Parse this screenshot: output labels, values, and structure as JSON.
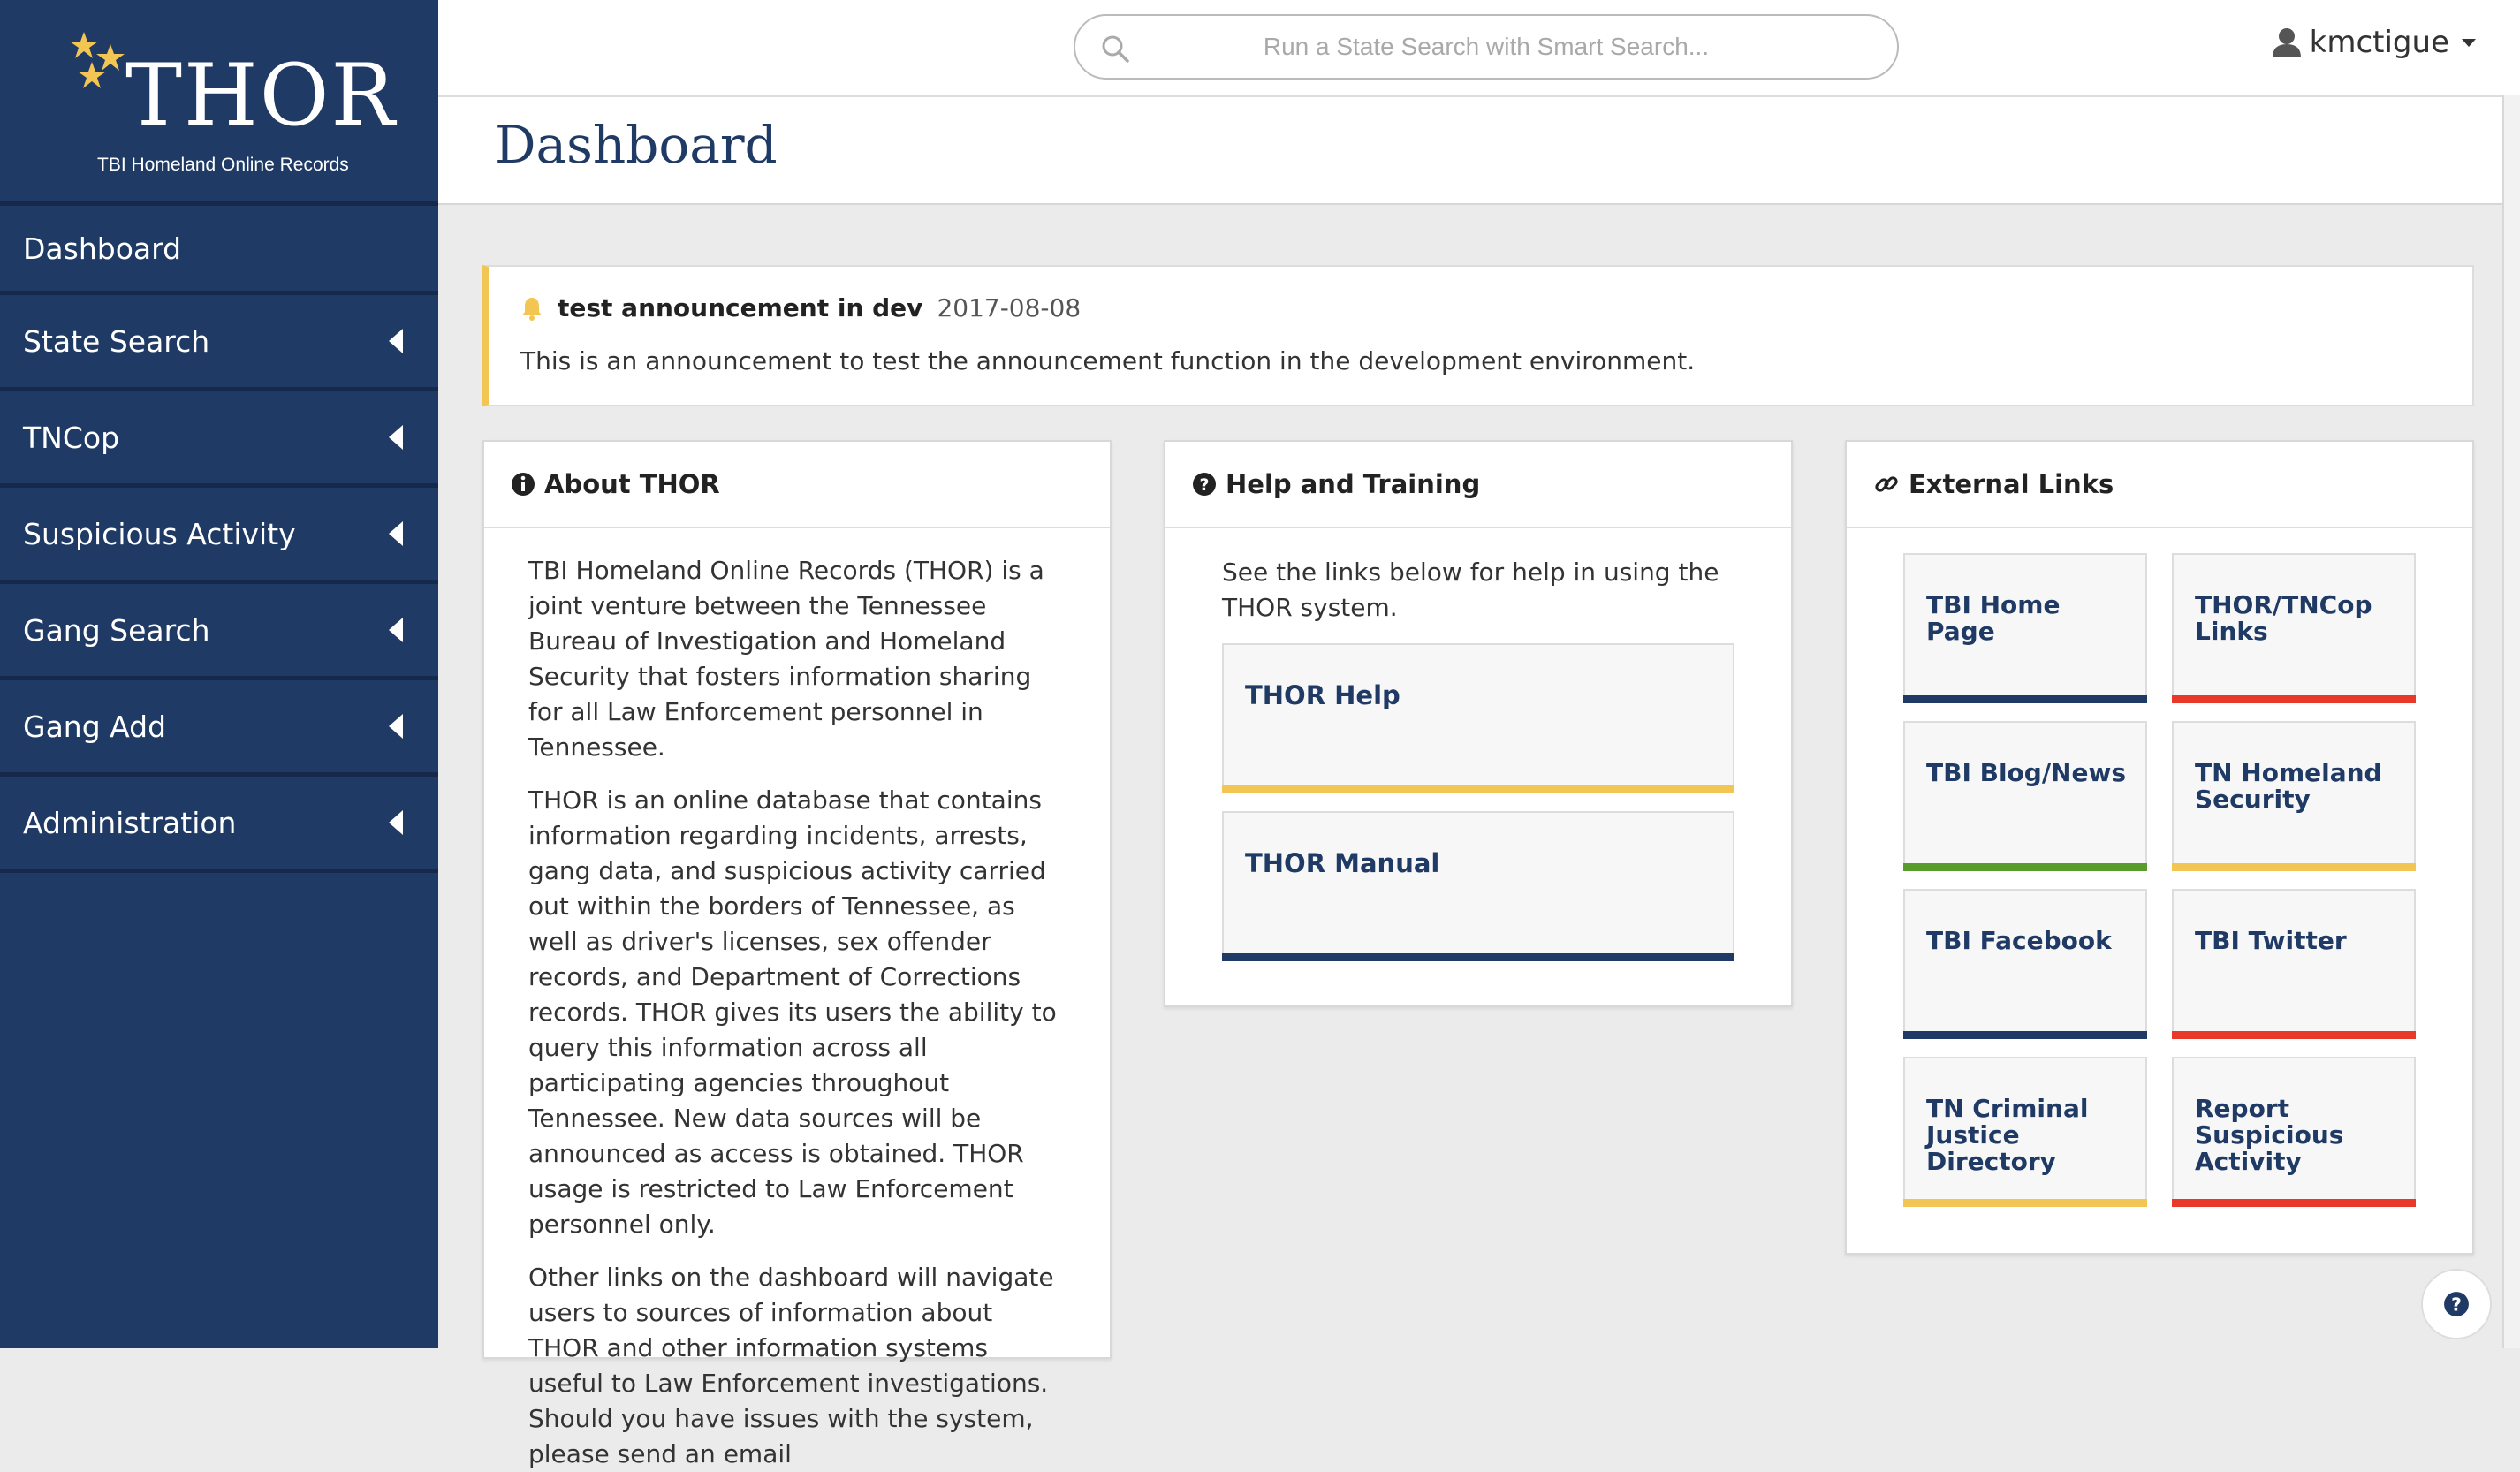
{
  "brand": {
    "name": "THOR",
    "tagline": "TBI Homeland Online Records"
  },
  "sidebar": {
    "items": [
      {
        "label": "Dashboard"
      },
      {
        "label": "State Search"
      },
      {
        "label": "TNCop"
      },
      {
        "label": "Suspicious Activity"
      },
      {
        "label": "Gang Search"
      },
      {
        "label": "Gang Add"
      },
      {
        "label": "Administration"
      }
    ]
  },
  "header": {
    "search_placeholder": "Run a State Search with Smart Search...",
    "username": "kmctigue"
  },
  "page": {
    "title": "Dashboard"
  },
  "announcement": {
    "title": "test announcement in dev",
    "date": "2017-08-08",
    "body": "This is an announcement to test the announcement function in the development environment."
  },
  "about": {
    "heading": "About THOR",
    "paragraphs": [
      "TBI Homeland Online Records (THOR) is a joint venture between the Tennessee Bureau of Investigation and Homeland Security that fosters information sharing for all Law Enforcement personnel in Tennessee.",
      "THOR is an online database that contains information regarding incidents, arrests, gang data, and suspicious activity carried out within the borders of Tennessee, as well as driver's licenses, sex offender records, and Department of Corrections records. THOR gives its users the ability to query this information across all participating agencies throughout Tennessee. New data sources will be announced as access is obtained. THOR usage is restricted to Law Enforcement personnel only.",
      "Other links on the dashboard will navigate users to sources of information about THOR and other information systems useful to Law Enforcement investigations. Should you have issues with the system, please send an email"
    ]
  },
  "help": {
    "heading": "Help and Training",
    "intro": "See the links below for help in using the THOR system.",
    "tiles": [
      {
        "label": "THOR Help",
        "color": "#f3c553"
      },
      {
        "label": "THOR Manual",
        "color": "#1f3a64"
      }
    ]
  },
  "links": {
    "heading": "External Links",
    "tiles": [
      {
        "label": "TBI Home Page",
        "color": "#1f3a64"
      },
      {
        "label": "THOR/TNCop Links",
        "color": "#e8392b"
      },
      {
        "label": "TBI Blog/News",
        "color": "#5a9b2e"
      },
      {
        "label": "TN Homeland Security",
        "color": "#f3c553"
      },
      {
        "label": "TBI Facebook",
        "color": "#1f3a64"
      },
      {
        "label": "TBI Twitter",
        "color": "#e8392b"
      },
      {
        "label": "TN Criminal Justice Directory",
        "color": "#f3c553"
      },
      {
        "label": "Report Suspicious Activity",
        "color": "#e8392b"
      }
    ]
  },
  "colors": {
    "navy": "#1f3a64",
    "gold": "#f3c553",
    "red": "#e8392b",
    "green": "#5a9b2e"
  }
}
